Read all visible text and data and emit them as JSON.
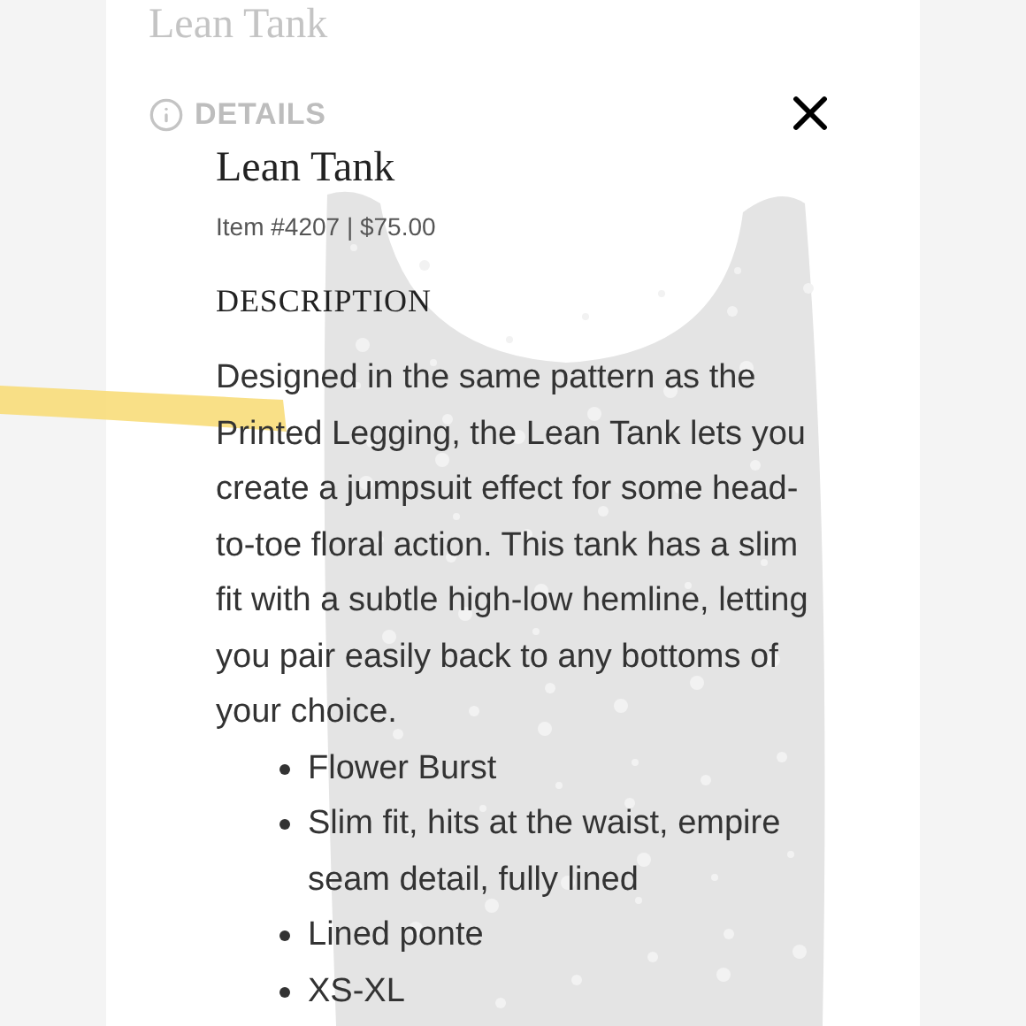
{
  "background_page": {
    "title": "Lean Tank",
    "section": "DETAILS"
  },
  "modal": {
    "title": "Lean Tank",
    "meta": "Item #4207 | $75.00",
    "heading": "DESCRIPTION",
    "description": "Designed in the same pattern as the Printed Legging, the Lean Tank lets you create a jumpsuit effect for some head-to-toe floral action. This tank has a slim fit with a subtle high-low hemline, letting you pair easily back to any bottoms of your choice.",
    "bullets": [
      "Flower Burst",
      "Slim fit, hits at the waist, empire seam detail, fully lined",
      "Lined ponte",
      "XS-XL"
    ]
  }
}
